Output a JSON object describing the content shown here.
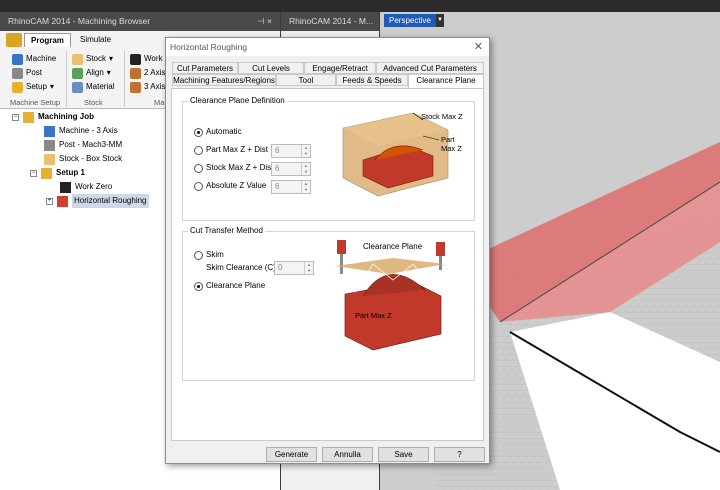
{
  "browser": {
    "title": "RhinoCAM 2014 - Machining Browser",
    "tabs": [
      "Program",
      "Simulate"
    ],
    "ribbon": {
      "machine": "Machine",
      "post": "Post",
      "setup": "Setup",
      "stock": "Stock",
      "align": "Align",
      "material": "Material",
      "work": "Work",
      "axis2": "2 Axis",
      "axis3": "3 Axis",
      "group_machine_setup": "Machine Setup",
      "group_stock": "Stock",
      "group_ma": "Ma"
    },
    "tree": {
      "root": "Machining Job",
      "machine": "Machine - 3 Axis",
      "post": "Post - Mach3-MM",
      "stock": "Stock - Box Stock",
      "setup": "Setup 1",
      "work_zero": "Work Zero",
      "op": "Horizontal Roughing"
    }
  },
  "panel2": {
    "title": "RhinoCAM 2014 - M..."
  },
  "viewport": {
    "label": "Perspective"
  },
  "dialog": {
    "title": "Horizontal Roughing",
    "tabs_row1": [
      "Cut Parameters",
      "Cut Levels",
      "Engage/Retract",
      "Advanced Cut Parameters"
    ],
    "tabs_row2": [
      "Machining Features/Regions",
      "Tool",
      "Feeds & Speeds",
      "Clearance Plane"
    ],
    "clearance_group": {
      "legend": "Clearance Plane Definition",
      "options": [
        "Automatic",
        "Part Max Z + Dist",
        "Stock Max Z + Dist",
        "Absolute Z Value"
      ],
      "values": [
        "6",
        "6",
        "6"
      ],
      "img_label_stock": "Stock Max Z",
      "img_label_part1": "Part",
      "img_label_part2": "Max Z"
    },
    "transfer_group": {
      "legend": "Cut Transfer Method",
      "skim": "Skim",
      "skim_clearance": "Skim Clearance (C)",
      "skim_value": "0",
      "clearance_plane": "Clearance Plane",
      "img_label_plane": "Clearance Plane",
      "img_label_part": "Part Max Z"
    },
    "buttons": [
      "Generate",
      "Annulla",
      "Save",
      "?"
    ]
  },
  "colors": {
    "accent": "#1e5bb6",
    "stock": "#d8a560",
    "part": "#c0392b",
    "grid_red": "#e06060"
  }
}
